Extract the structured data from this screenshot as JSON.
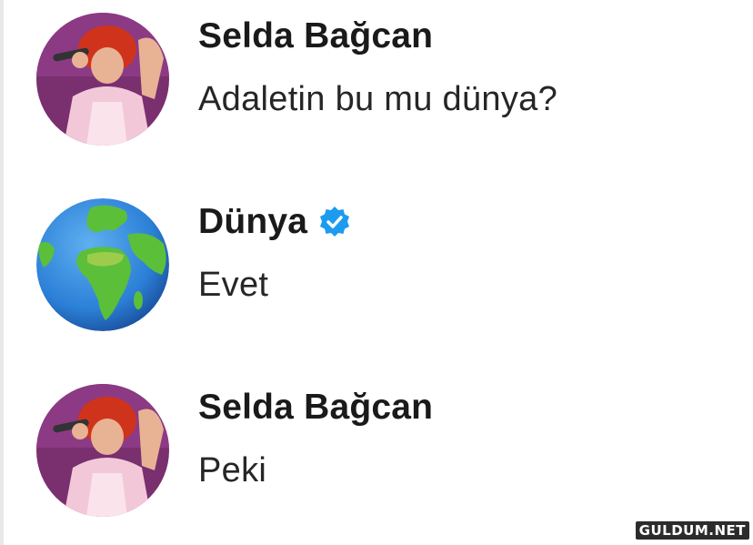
{
  "messages": [
    {
      "name": "Selda Bağcan",
      "text": "Adaletin bu mu dünya?",
      "verified": false,
      "avatar": "singer-photo-avatar"
    },
    {
      "name": "Dünya",
      "text": "Evet",
      "verified": true,
      "avatar": "earth-globe-icon"
    },
    {
      "name": "Selda Bağcan",
      "text": "Peki",
      "verified": false,
      "avatar": "singer-photo-avatar"
    }
  ],
  "colors": {
    "verified_badge": "#1d9bf0",
    "name_text": "#1a1a1a",
    "message_text": "#262626",
    "ocean": "#2b7fd6",
    "land": "#5bbf3a"
  },
  "watermark": "GULDUM.NET"
}
